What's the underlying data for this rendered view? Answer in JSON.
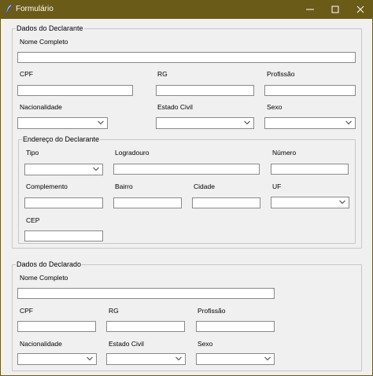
{
  "window": {
    "title": "Formulário",
    "titlebar_color": "#6b5b18"
  },
  "declarante": {
    "legend": "Dados do Declarante",
    "nome_completo": "Nome Completo",
    "cpf": "CPF",
    "rg": "RG",
    "profissao": "Profissão",
    "nacionalidade": "Nacionalidade",
    "estado_civil": "Estado Civil",
    "sexo": "Sexo",
    "endereco": {
      "legend": "Endereço do Declarante",
      "tipo": "Tipo",
      "logradouro": "Logradouro",
      "numero": "Número",
      "complemento": "Complemento",
      "bairro": "Bairro",
      "cidade": "Cidade",
      "uf": "UF",
      "cep": "CEP"
    }
  },
  "declarado": {
    "legend": "Dados do Declarado",
    "nome_completo": "Nome Completo",
    "cpf": "CPF",
    "rg": "RG",
    "profissao": "Profissão",
    "nacionalidade": "Nacionalidade",
    "estado_civil": "Estado Civil",
    "sexo": "Sexo"
  }
}
